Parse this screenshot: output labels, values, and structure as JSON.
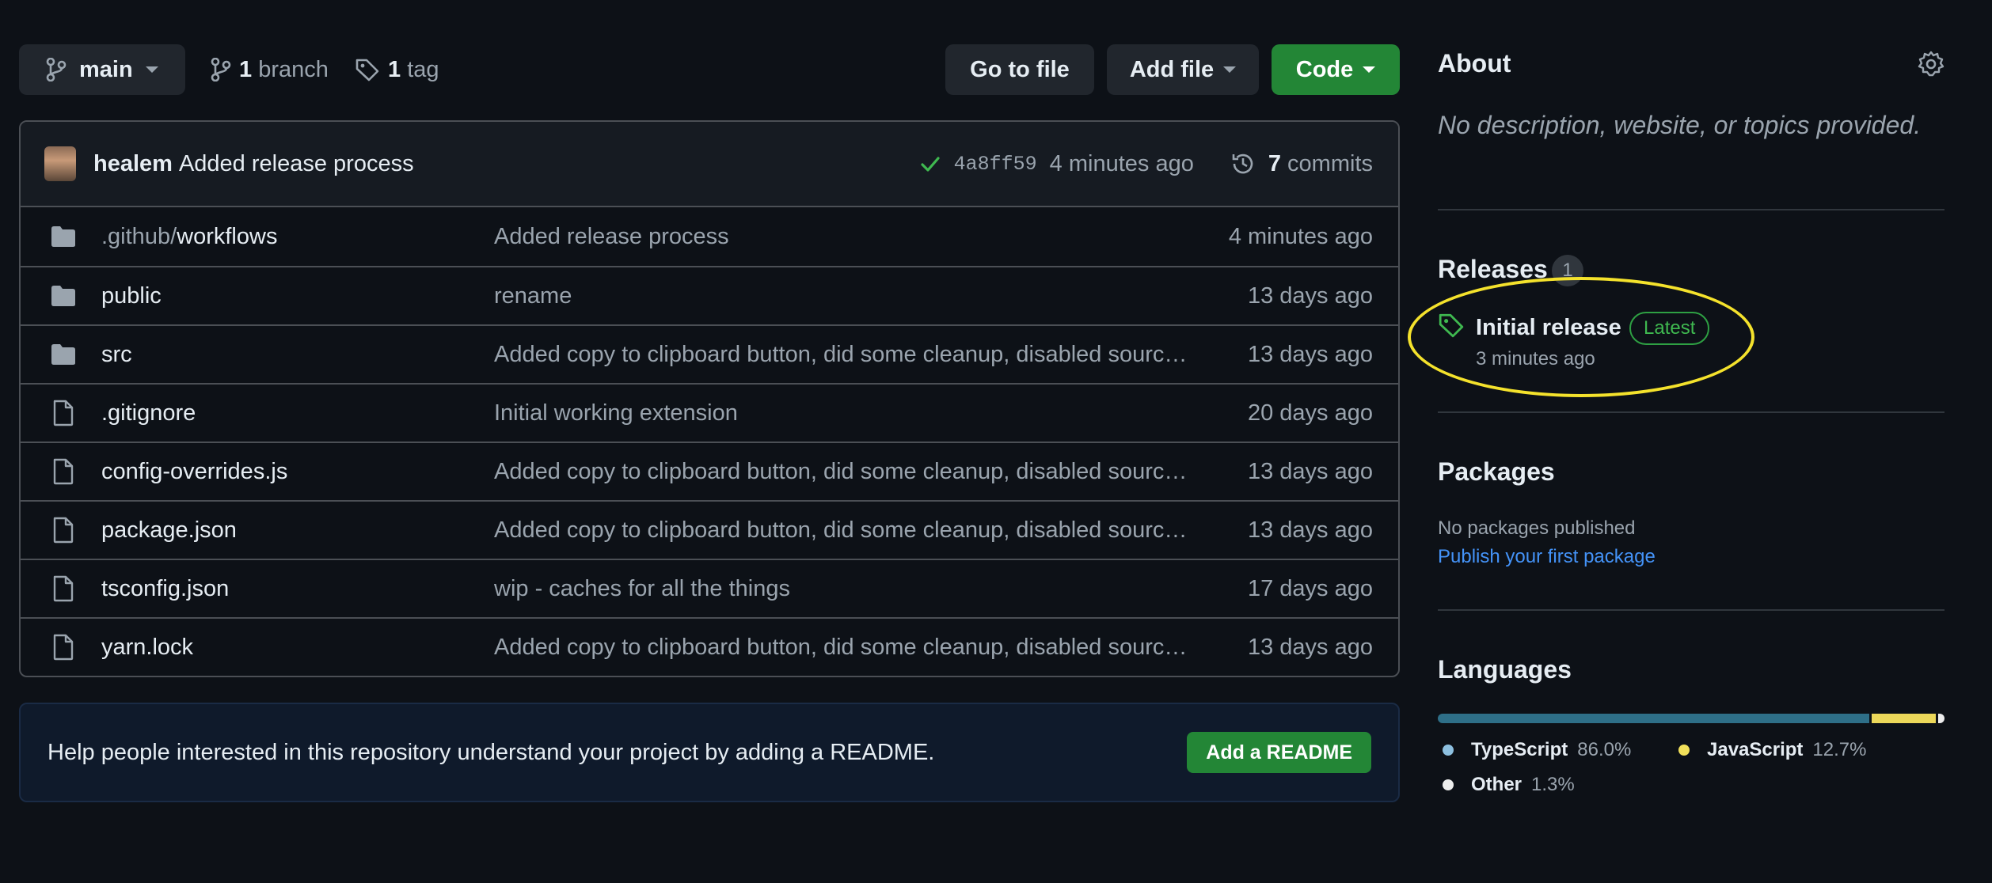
{
  "colors": {
    "background": "#0d1117",
    "button_green": "#238636",
    "link_blue": "#4493f8",
    "success_green": "#3fb950",
    "highlight_yellow": "#f4e22c"
  },
  "toolbar": {
    "branch_name": "main",
    "branches_count": "1",
    "branches_label": "branch",
    "tags_count": "1",
    "tags_label": "tag",
    "go_to_file": "Go to file",
    "add_file": "Add file",
    "code": "Code"
  },
  "latest_commit": {
    "author": "healem",
    "message": "Added release process",
    "sha": "4a8ff59",
    "time": "4 minutes ago",
    "commits_count": "7",
    "commits_label": "commits"
  },
  "files": [
    {
      "type": "folder",
      "name_prefix": ".github/",
      "name": "workflows",
      "message": "Added release process",
      "age": "4 minutes ago"
    },
    {
      "type": "folder",
      "name_prefix": "",
      "name": "public",
      "message": "rename",
      "age": "13 days ago"
    },
    {
      "type": "folder",
      "name_prefix": "",
      "name": "src",
      "message": "Added copy to clipboard button, did some cleanup, disabled sourc…",
      "age": "13 days ago"
    },
    {
      "type": "file",
      "name_prefix": "",
      "name": ".gitignore",
      "message": "Initial working extension",
      "age": "20 days ago"
    },
    {
      "type": "file",
      "name_prefix": "",
      "name": "config-overrides.js",
      "message": "Added copy to clipboard button, did some cleanup, disabled sourc…",
      "age": "13 days ago"
    },
    {
      "type": "file",
      "name_prefix": "",
      "name": "package.json",
      "message": "Added copy to clipboard button, did some cleanup, disabled sourc…",
      "age": "13 days ago"
    },
    {
      "type": "file",
      "name_prefix": "",
      "name": "tsconfig.json",
      "message": "wip - caches for all the things",
      "age": "17 days ago"
    },
    {
      "type": "file",
      "name_prefix": "",
      "name": "yarn.lock",
      "message": "Added copy to clipboard button, did some cleanup, disabled sourc…",
      "age": "13 days ago"
    }
  ],
  "readme_banner": {
    "text": "Help people interested in this repository understand your project by adding a README.",
    "button": "Add a README"
  },
  "sidebar": {
    "about": {
      "title": "About",
      "description": "No description, website, or topics provided."
    },
    "releases": {
      "title": "Releases",
      "count": "1",
      "latest_name": "Initial release",
      "latest_badge": "Latest",
      "latest_time": "3 minutes ago"
    },
    "packages": {
      "title": "Packages",
      "none_text": "No packages published",
      "publish_link": "Publish your first package"
    },
    "languages": {
      "title": "Languages",
      "items": [
        {
          "name": "TypeScript",
          "percent": "86.0%",
          "value": 86.0,
          "color": "#3178c6"
        },
        {
          "name": "JavaScript",
          "percent": "12.7%",
          "value": 12.7,
          "color": "#f1e05a"
        },
        {
          "name": "Other",
          "percent": "1.3%",
          "value": 1.3,
          "color": "#ededed"
        }
      ]
    }
  }
}
